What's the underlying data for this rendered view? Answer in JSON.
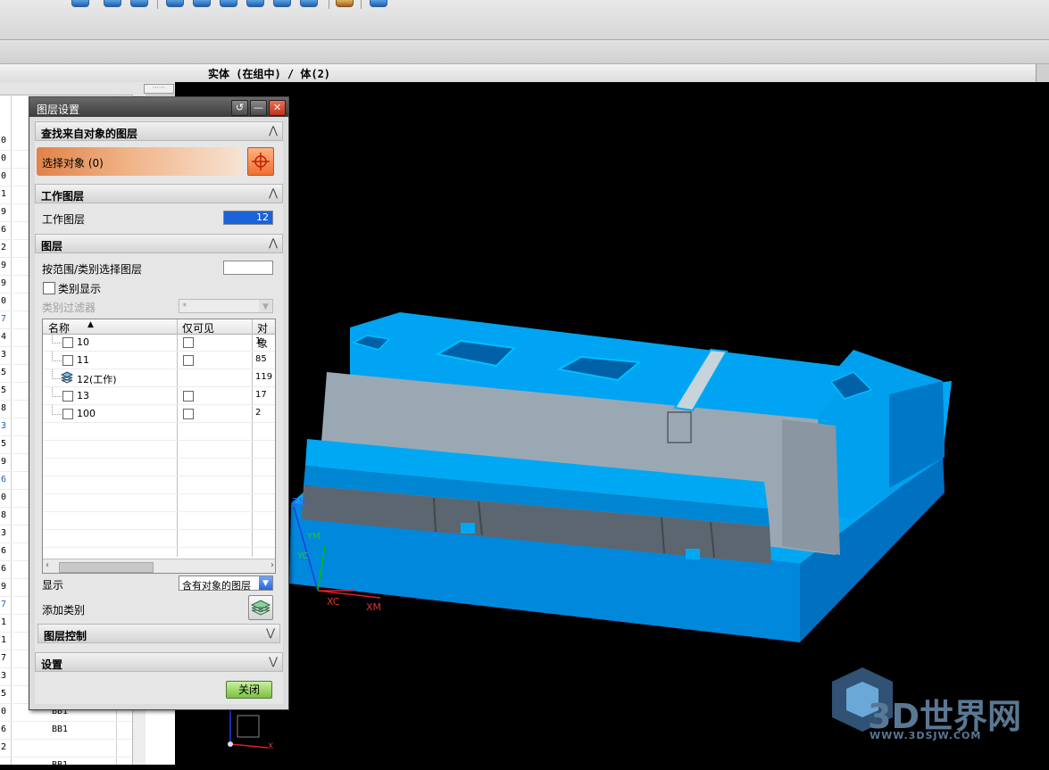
{
  "window": {
    "graphics_title": "实体 (在组中) / 体(2)"
  },
  "navigator": {
    "row_numbers": [
      "0",
      "0",
      "0",
      "1",
      "9",
      "6",
      "2",
      "9",
      "9",
      "0",
      "7",
      "4",
      "3",
      "5",
      "5",
      "8",
      "3",
      "5",
      "9",
      "6",
      "0",
      "8",
      "3",
      "6",
      "6",
      "9",
      "7",
      "1",
      "1",
      "7",
      "3",
      "5",
      "0",
      "6",
      "2"
    ],
    "bb_labels": [
      "BB1",
      "BB1",
      "BB1"
    ]
  },
  "dialog": {
    "title": "图层设置",
    "sections": {
      "find": "查找来自对象的图层",
      "work": "工作图层",
      "layers": "图层",
      "layer_control": "图层控制",
      "settings": "设置"
    },
    "select_object": "选择对象 (0)",
    "work_layer_label": "工作图层",
    "work_layer_value": "12",
    "range_label": "按范围/类别选择图层",
    "category_display": "类别显示",
    "category_filter_label": "类别过滤器",
    "category_filter_value": "*",
    "list": {
      "headers": [
        "名称",
        "仅可见",
        "对象"
      ],
      "rows": [
        {
          "name": "10",
          "count": "1",
          "work": false
        },
        {
          "name": "11",
          "count": "85",
          "work": false
        },
        {
          "name": "12(工作)",
          "count": "119",
          "work": true
        },
        {
          "name": "13",
          "count": "17",
          "work": false
        },
        {
          "name": "100",
          "count": "2",
          "work": false
        }
      ]
    },
    "display_label": "显示",
    "display_value": "含有对象的图层",
    "add_category_label": "添加类别",
    "close_button": "关闭"
  },
  "viewport": {
    "axes": {
      "zm": "ZM",
      "ym": "YM",
      "yc": "YC",
      "xc": "XC",
      "xm": "XM",
      "x": "X"
    },
    "watermark": {
      "brand": "3D世界网",
      "url": "WWW.3DSJW.COM"
    },
    "colors": {
      "part": "#00a0f0",
      "part_dark": "#0070c0",
      "shade": "#9aa6b0"
    }
  }
}
